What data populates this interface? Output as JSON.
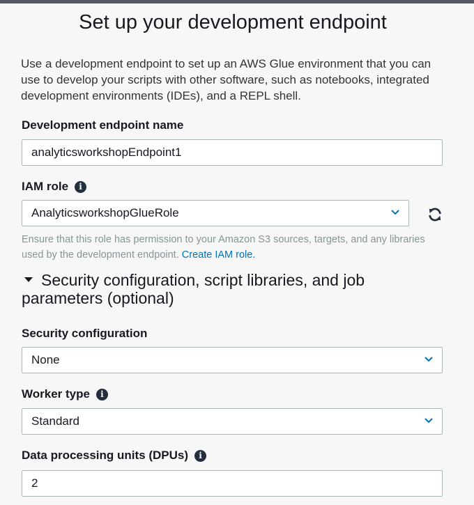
{
  "page": {
    "title": "Set up your development endpoint",
    "intro": "Use a development endpoint to set up an AWS Glue environment that you can use to develop your scripts with other software, such as notebooks, integrated development environments (IDEs), and a REPL shell."
  },
  "endpoint_name": {
    "label": "Development endpoint name",
    "value": "analyticsworkshopEndpoint1"
  },
  "iam_role": {
    "label": "IAM role",
    "value": "AnalyticsworkshopGlueRole",
    "hint": "Ensure that this role has permission to your Amazon S3 sources, targets, and any libraries used by the development endpoint.",
    "hint_link": "Create IAM role."
  },
  "section": {
    "label": "Security configuration, script libraries, and job parameters (optional)"
  },
  "security_config": {
    "label": "Security configuration",
    "value": "None"
  },
  "worker_type": {
    "label": "Worker type",
    "value": "Standard"
  },
  "dpu": {
    "label": "Data processing units (DPUs)",
    "value": "2"
  },
  "icons": {
    "info": "i",
    "info_icon": "info-circle-icon",
    "refresh_icon": "refresh-icon",
    "chevron_icon": "chevron-down-icon",
    "caret_icon": "caret-down-icon"
  },
  "colors": {
    "link": "#0073bb",
    "border": "#aab7b8",
    "chevron": "#0073bb"
  }
}
